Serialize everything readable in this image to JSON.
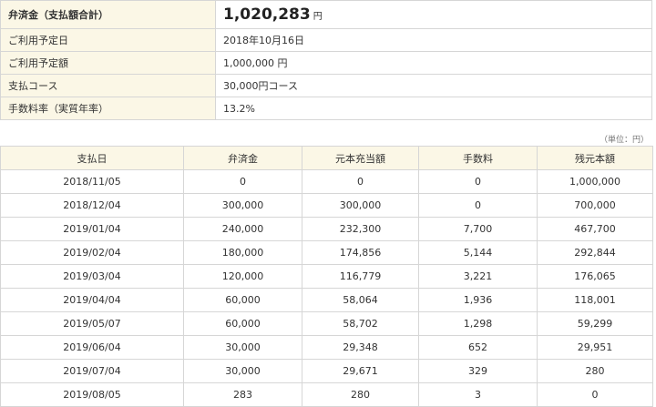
{
  "summary": {
    "rows": [
      {
        "label": "弁済金（支払額合計）",
        "value": "1,020,283",
        "unit": "円"
      },
      {
        "label": "ご利用予定日",
        "value": "2018年10月16日"
      },
      {
        "label": "ご利用予定額",
        "value": "1,000,000 円"
      },
      {
        "label": "支払コース",
        "value": "30,000円コース"
      },
      {
        "label": "手数料率（実質年率）",
        "value": "13.2%"
      }
    ]
  },
  "unit_note": "（単位：円）",
  "schedule": {
    "headers": [
      "支払日",
      "弁済金",
      "元本充当額",
      "手数料",
      "残元本額"
    ],
    "rows": [
      [
        "2018/11/05",
        "0",
        "0",
        "0",
        "1,000,000"
      ],
      [
        "2018/12/04",
        "300,000",
        "300,000",
        "0",
        "700,000"
      ],
      [
        "2019/01/04",
        "240,000",
        "232,300",
        "7,700",
        "467,700"
      ],
      [
        "2019/02/04",
        "180,000",
        "174,856",
        "5,144",
        "292,844"
      ],
      [
        "2019/03/04",
        "120,000",
        "116,779",
        "3,221",
        "176,065"
      ],
      [
        "2019/04/04",
        "60,000",
        "58,064",
        "1,936",
        "118,001"
      ],
      [
        "2019/05/07",
        "60,000",
        "58,702",
        "1,298",
        "59,299"
      ],
      [
        "2019/06/04",
        "30,000",
        "29,348",
        "652",
        "29,951"
      ],
      [
        "2019/07/04",
        "30,000",
        "29,671",
        "329",
        "280"
      ],
      [
        "2019/08/05",
        "283",
        "280",
        "3",
        "0"
      ]
    ]
  }
}
